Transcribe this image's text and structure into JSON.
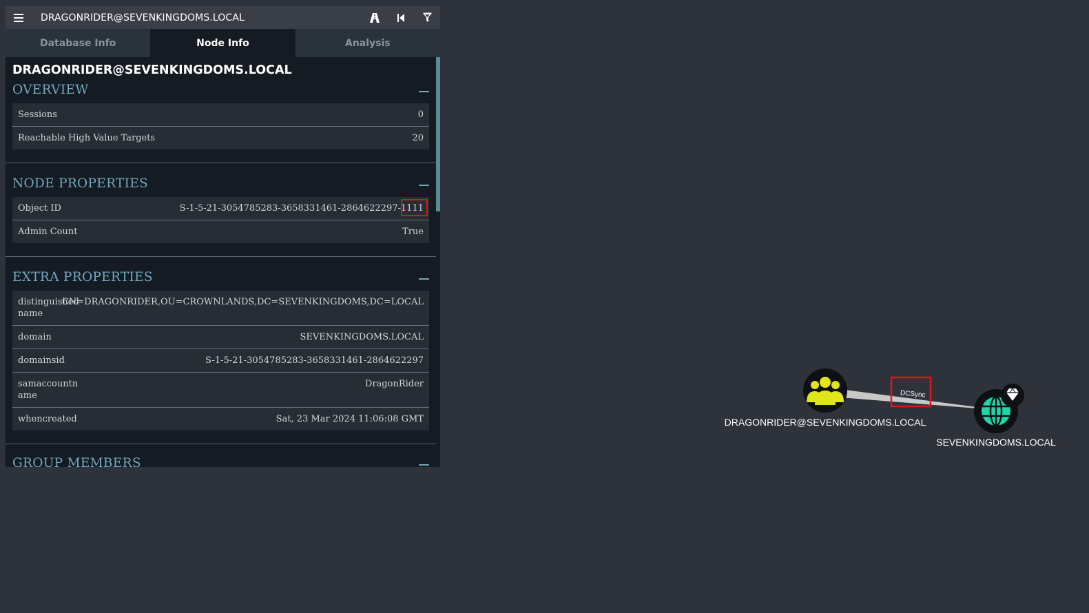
{
  "header": {
    "title": "DRAGONRIDER@SEVENKINGDOMS.LOCAL",
    "icons": [
      "menu-icon",
      "pathfinding-icon",
      "back-icon",
      "filter-icon"
    ]
  },
  "tabs": [
    {
      "label": "Database Info"
    },
    {
      "label": "Node Info"
    },
    {
      "label": "Analysis"
    }
  ],
  "active_tab": "Node Info",
  "panel": {
    "node_name": "DRAGONRIDER@SEVENKINGDOMS.LOCAL",
    "overview": {
      "title": "OVERVIEW",
      "rows": [
        {
          "key": "Sessions",
          "value": "0"
        },
        {
          "key": "Reachable High Value Targets",
          "value": "20"
        }
      ]
    },
    "node_properties": {
      "title": "NODE PROPERTIES",
      "rows": [
        {
          "key": "Object ID",
          "value": "S-1-5-21-3054785283-3658331461-2864622297-1111"
        },
        {
          "key": "Admin Count",
          "value": "True"
        }
      ]
    },
    "extra_properties": {
      "title": "EXTRA PROPERTIES",
      "rows": [
        {
          "key": "distinguished\nname",
          "value": "CN=DRAGONRIDER,OU=CROWNLANDS,DC=SEVENKINGDOMS,DC=LOCAL"
        },
        {
          "key": "domain",
          "value": "SEVENKINGDOMS.LOCAL"
        },
        {
          "key": "domainsid",
          "value": "S-1-5-21-3054785283-3658331461-2864622297"
        },
        {
          "key": "samaccountn\name",
          "value": "DragonRider"
        },
        {
          "key": "whencreated",
          "value": "Sat, 23 Mar 2024 11:06:08 GMT"
        }
      ]
    },
    "group_members": {
      "title": "GROUP MEMBERS"
    }
  },
  "graph": {
    "source_label": "DRAGONRIDER@SEVENKINGDOMS.LOCAL",
    "target_label": "SEVENKINGDOMS.LOCAL",
    "edge_label": "DCSync",
    "source_icon": "group-icon",
    "target_icon": "domain-globe-icon",
    "badge_icon": "high-value-diamond-icon"
  },
  "colors": {
    "background": "#2e333b",
    "panel": "#151b22",
    "section_title": "#73a7be",
    "group_node": "#e1e61a",
    "domain_node": "#1ed7a6",
    "highlight": "#e01414"
  }
}
